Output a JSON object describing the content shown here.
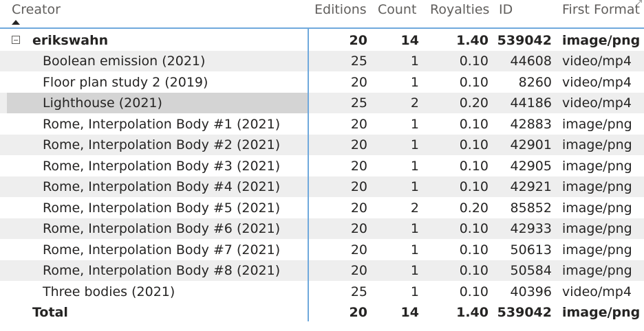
{
  "columns": {
    "creator": "Creator",
    "editions": "Editions",
    "count": "Count",
    "royalties": "Royalties",
    "id": "ID",
    "first_format": "First Format"
  },
  "group": {
    "name": "erikswahn",
    "editions": "20",
    "count": "14",
    "royalties": "1.40",
    "id": "539042",
    "first_format": "image/png"
  },
  "rows": [
    {
      "name": "Boolean emission (2021)",
      "editions": "25",
      "count": "1",
      "royalties": "0.10",
      "id": "44608",
      "first_format": "video/mp4"
    },
    {
      "name": "Floor plan study 2 (2019)",
      "editions": "20",
      "count": "1",
      "royalties": "0.10",
      "id": "8260",
      "first_format": "video/mp4"
    },
    {
      "name": "Lighthouse (2021)",
      "editions": "25",
      "count": "2",
      "royalties": "0.20",
      "id": "44186",
      "first_format": "video/mp4"
    },
    {
      "name": "Rome, Interpolation Body #1 (2021)",
      "editions": "20",
      "count": "1",
      "royalties": "0.10",
      "id": "42883",
      "first_format": "image/png"
    },
    {
      "name": "Rome, Interpolation Body #2 (2021)",
      "editions": "20",
      "count": "1",
      "royalties": "0.10",
      "id": "42901",
      "first_format": "image/png"
    },
    {
      "name": "Rome, Interpolation Body #3 (2021)",
      "editions": "20",
      "count": "1",
      "royalties": "0.10",
      "id": "42905",
      "first_format": "image/png"
    },
    {
      "name": "Rome, Interpolation Body #4 (2021)",
      "editions": "20",
      "count": "1",
      "royalties": "0.10",
      "id": "42921",
      "first_format": "image/png"
    },
    {
      "name": "Rome, Interpolation Body #5 (2021)",
      "editions": "20",
      "count": "2",
      "royalties": "0.20",
      "id": "85852",
      "first_format": "image/png"
    },
    {
      "name": "Rome, Interpolation Body #6 (2021)",
      "editions": "20",
      "count": "1",
      "royalties": "0.10",
      "id": "42933",
      "first_format": "image/png"
    },
    {
      "name": "Rome, Interpolation Body #7 (2021)",
      "editions": "20",
      "count": "1",
      "royalties": "0.10",
      "id": "50613",
      "first_format": "image/png"
    },
    {
      "name": "Rome, Interpolation Body #8 (2021)",
      "editions": "20",
      "count": "1",
      "royalties": "0.10",
      "id": "50584",
      "first_format": "image/png"
    },
    {
      "name": "Three bodies (2021)",
      "editions": "25",
      "count": "1",
      "royalties": "0.10",
      "id": "40396",
      "first_format": "video/mp4"
    }
  ],
  "total": {
    "label": "Total",
    "editions": "20",
    "count": "14",
    "royalties": "1.40",
    "id": "539042",
    "first_format": "image/png"
  }
}
